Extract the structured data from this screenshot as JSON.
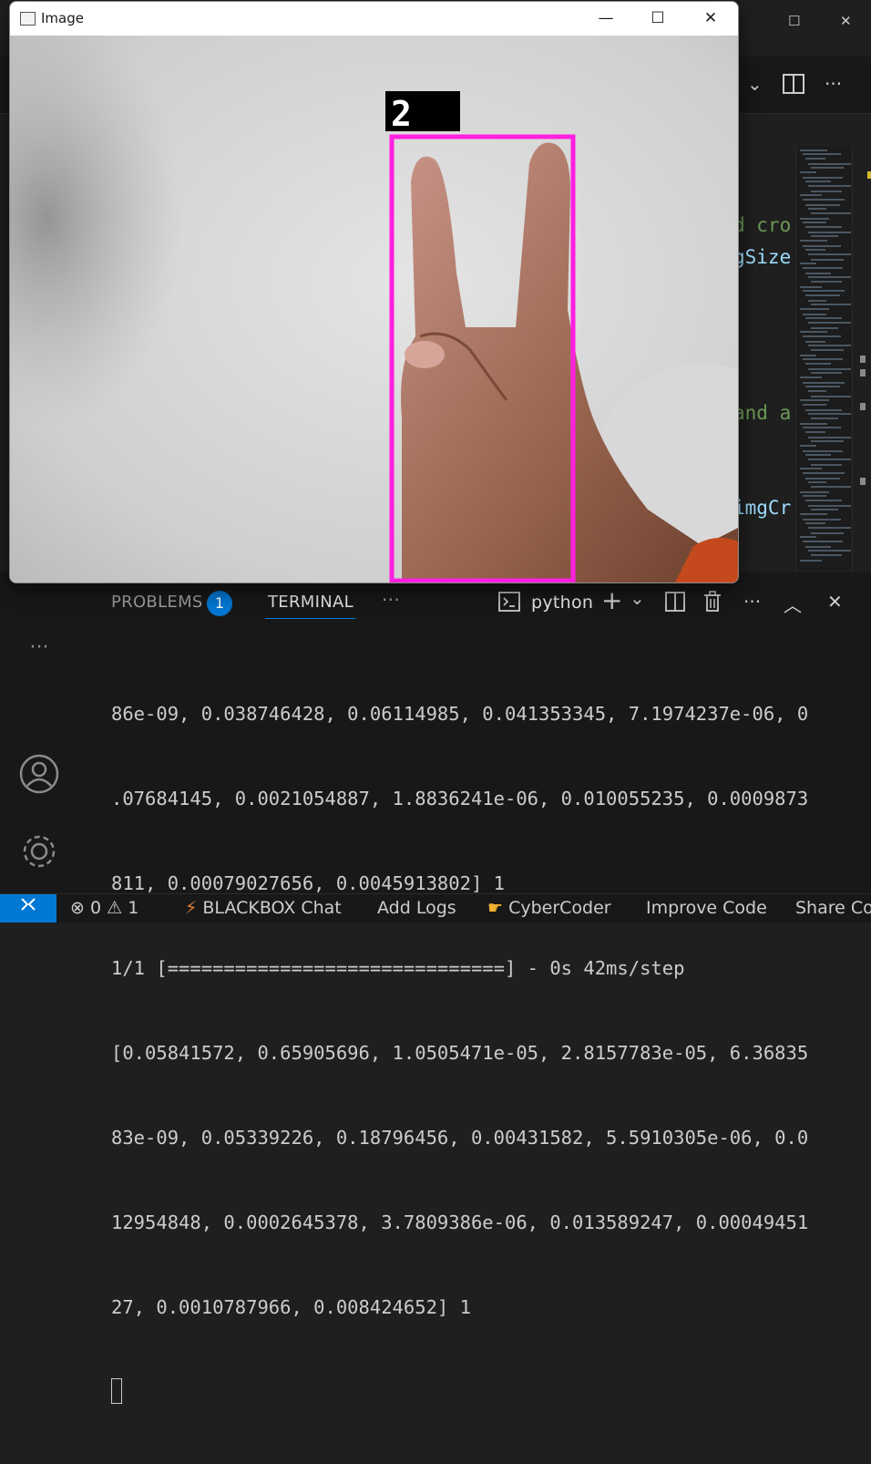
{
  "image_window": {
    "title": "Image",
    "controls": {
      "minimize": "—",
      "maximize": "☐",
      "close": "✕"
    },
    "prediction_label": "2",
    "box_color": "#ff1fe0"
  },
  "editor": {
    "code_fragments": [
      "d cro",
      "gSize",
      "and a",
      "imgCr"
    ]
  },
  "panel": {
    "tabs": {
      "problems": "PROBLEMS",
      "problems_badge": "1",
      "terminal": "TERMINAL",
      "more": "···"
    },
    "shell": "python",
    "terminal_lines": [
      "86e-09, 0.038746428, 0.06114985, 0.041353345, 7.1974237e-06, 0",
      ".07684145, 0.0021054887, 1.8836241e-06, 0.010055235, 0.0009873",
      "811, 0.00079027656, 0.0045913802] 1",
      "1/1 [==============================] - 0s 42ms/step",
      "[0.05841572, 0.65905696, 1.0505471e-05, 2.8157783e-05, 6.36835",
      "83e-09, 0.05339226, 0.18796456, 0.00431582, 5.5910305e-06, 0.0",
      "12954848, 0.0002645378, 3.7809386e-06, 0.013589247, 0.00049451",
      "27, 0.0010787966, 0.008424652] 1"
    ]
  },
  "statusbar": {
    "errors": "0",
    "warnings": "1",
    "blackbox": "BLACKBOX Chat",
    "add_logs": "Add Logs",
    "cybercoder": "CyberCoder",
    "improve_code": "Improve Code",
    "share_code": "Share Co"
  },
  "colors": {
    "accent": "#0078d4",
    "panel_bg": "#181818",
    "editor_bg": "#1f1f1f"
  }
}
